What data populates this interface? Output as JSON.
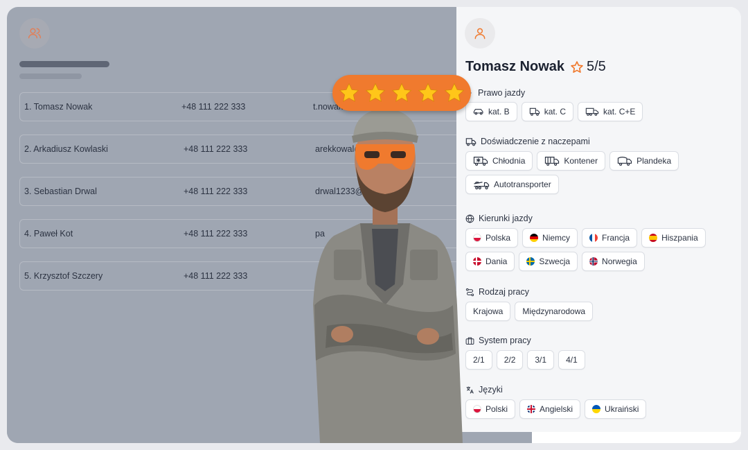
{
  "list": {
    "rows": [
      {
        "name": "1. Tomasz Nowak",
        "phone": "+48 111 222 333",
        "email": "t.nowak"
      },
      {
        "name": "2.  Arkadiusz Kowlaski",
        "phone": "+48 111 222 333",
        "email": "arekkowal@mai"
      },
      {
        "name": "3.  Sebastian Drwal",
        "phone": "+48 111 222 333",
        "email": "drwal1233@mail.c"
      },
      {
        "name": "4.  Paweł Kot",
        "phone": "+48 111 222 333",
        "email": "pa"
      },
      {
        "name": "5.  Krzysztof Szczery",
        "phone": "+48 111 222 333",
        "email": ""
      }
    ]
  },
  "profile": {
    "name": "Tomasz Nowak",
    "rating": "5/5",
    "sections": {
      "license": {
        "title": "Prawo jazdy",
        "items": [
          "kat. B",
          "kat. C",
          "kat. C+E"
        ]
      },
      "trailers": {
        "title": "Doświadczenie z naczepami",
        "items": [
          "Chłodnia",
          "Kontener",
          "Plandeka",
          "Autotransporter"
        ]
      },
      "directions": {
        "title": "Kierunki jazdy",
        "items": [
          "Polska",
          "Niemcy",
          "Francja",
          "Hiszpania",
          "Dania",
          "Szwecja",
          "Norwegia"
        ]
      },
      "worktype": {
        "title": "Rodzaj pracy",
        "items": [
          "Krajowa",
          "Międzynarodowa"
        ]
      },
      "schedule": {
        "title": "System pracy",
        "items": [
          "2/1",
          "2/2",
          "3/1",
          "4/1"
        ]
      },
      "languages": {
        "title": "Języki",
        "items": [
          "Polski",
          "Angielski",
          "Ukraiński"
        ]
      }
    }
  },
  "colors": {
    "accent": "#f07a2e",
    "leftPanel": "#9fa6b2",
    "star": "#ffc619"
  }
}
